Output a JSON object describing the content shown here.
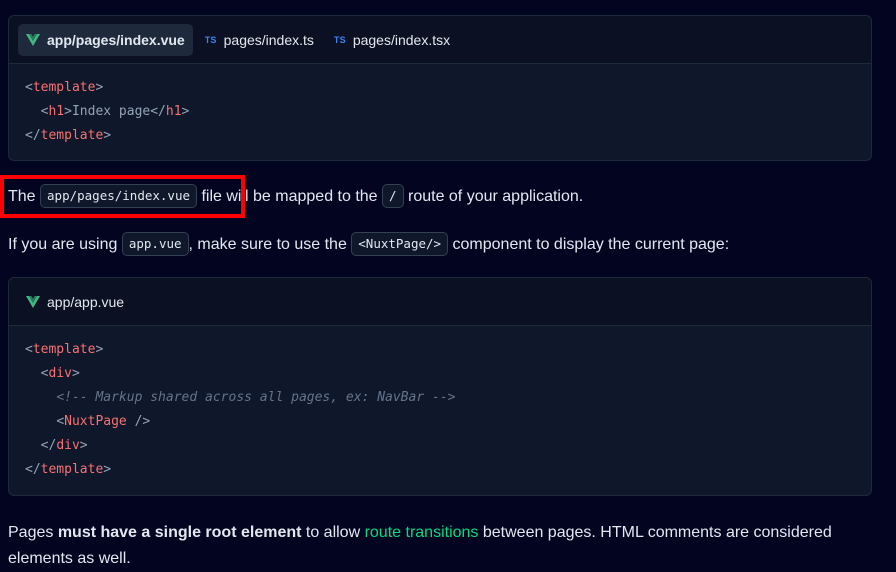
{
  "card1": {
    "tabs": [
      {
        "label": "app/pages/index.vue",
        "icon": "vue-icon",
        "active": true
      },
      {
        "label": "pages/index.ts",
        "icon": "ts-icon",
        "badge": "TS"
      },
      {
        "label": "pages/index.tsx",
        "icon": "ts-icon",
        "badge": "TS"
      }
    ],
    "code": {
      "l1_open": "<",
      "l1_tag": "template",
      "l1_close": ">",
      "l2_open": "<",
      "l2_tag": "h1",
      "l2_mid": ">Index page</",
      "l2_tag2": "h1",
      "l2_close": ">",
      "l3_open": "</",
      "l3_tag": "template",
      "l3_close": ">"
    }
  },
  "p1": {
    "t1": "The ",
    "chip1": "app/pages/index.vue",
    "t2": " file will be mapped to the ",
    "chip2": "/",
    "t3": " route of your application."
  },
  "p2": {
    "t1": "If you are using ",
    "chip1": "app.vue",
    "t2": ", make sure to use the ",
    "chip2": "<NuxtPage/>",
    "t3": " component to display the current page:"
  },
  "card2": {
    "tab_label": "app/app.vue",
    "code": {
      "l1_open": "<",
      "l1_tag": "template",
      "l1_close": ">",
      "l2_open": "<",
      "l2_tag": "div",
      "l2_close": ">",
      "l3_comment": "<!-- Markup shared across all pages, ex: NavBar -->",
      "l4_open": "<",
      "l4_tag": "NuxtPage",
      "l4_close": " />",
      "l5_open": "</",
      "l5_tag": "div",
      "l5_close": ">",
      "l6_open": "</",
      "l6_tag": "template",
      "l6_close": ">"
    }
  },
  "p3": {
    "t1": "Pages ",
    "bold": "must have a single root element",
    "t2": " to allow ",
    "link": "route transitions",
    "t3": " between pages. HTML comments are considered",
    "line2": "elements as well."
  },
  "colors": {
    "accent": "#00dc82",
    "highlight_box": "#ff0000",
    "tag": "#f87171"
  }
}
